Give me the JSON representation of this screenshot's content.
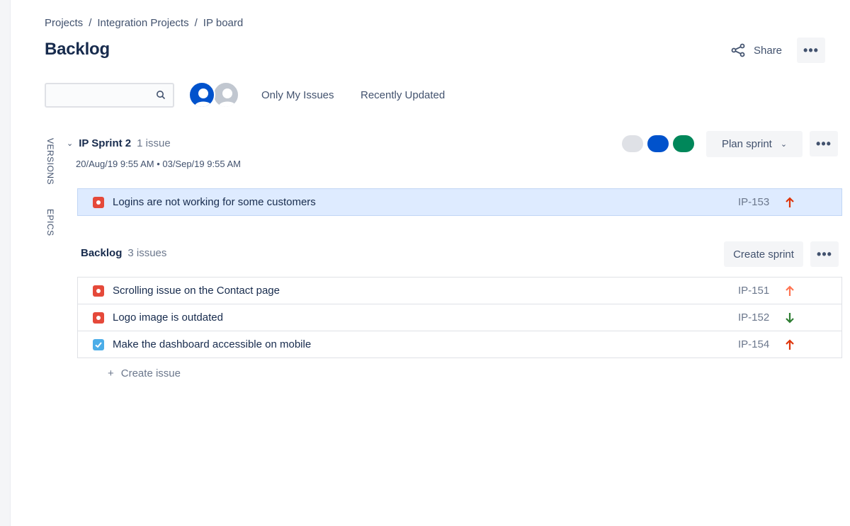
{
  "breadcrumb": [
    "Projects",
    "Integration Projects",
    "IP board"
  ],
  "breadcrumb_separator": "/",
  "page_title": "Backlog",
  "header": {
    "share_label": "Share",
    "more_label": "•••"
  },
  "filters": {
    "search_placeholder": "",
    "search_icon": "search-icon",
    "quick_filters": [
      "Only My Issues",
      "Recently Updated"
    ]
  },
  "side_tabs": [
    "VERSIONS",
    "EPICS"
  ],
  "sprint": {
    "name": "IP Sprint 2",
    "issue_count": "1 issue",
    "dates": "20/Aug/19 9:55 AM • 03/Sep/19 9:55 AM",
    "status_colors": [
      "#DFE1E6",
      "#0052CC",
      "#00875A"
    ],
    "plan_label": "Plan sprint",
    "more_label": "•••",
    "issues": [
      {
        "type": "bug",
        "summary": "Logins are not working for some customers",
        "key": "IP-153",
        "priority": "highest",
        "priority_color": "#DE350B"
      }
    ]
  },
  "backlog": {
    "label": "Backlog",
    "issue_count": "3 issues",
    "create_sprint_label": "Create sprint",
    "more_label": "•••",
    "issues": [
      {
        "type": "bug",
        "summary": "Scrolling issue on the Contact page",
        "key": "IP-151",
        "priority": "high",
        "priority_color": "#FF7452"
      },
      {
        "type": "bug",
        "summary": "Logo image is outdated",
        "key": "IP-152",
        "priority": "low",
        "priority_color": "#2E7D32"
      },
      {
        "type": "task",
        "summary": "Make the dashboard accessible on mobile",
        "key": "IP-154",
        "priority": "highest",
        "priority_color": "#DE350B"
      }
    ],
    "create_issue_label": "Create issue"
  },
  "colors": {
    "accent": "#0052CC",
    "selected_row": "#DEEBFF"
  }
}
